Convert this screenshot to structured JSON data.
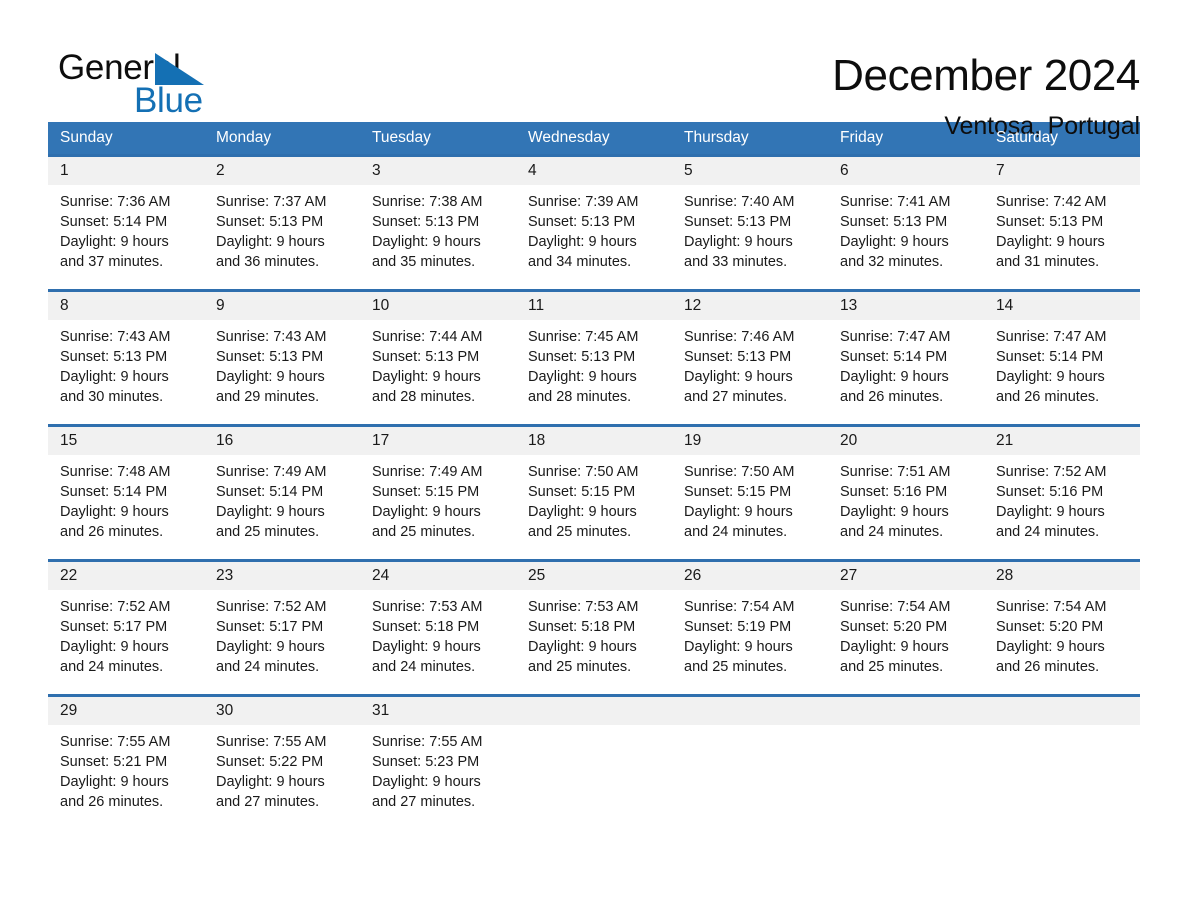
{
  "brand": {
    "word_general": "General",
    "word_blue": "Blue",
    "accent_color": "#1470b4"
  },
  "header": {
    "title": "December 2024",
    "subtitle": "Ventosa, Portugal"
  },
  "theme": {
    "header_blue": "#3275b5",
    "row_divider_blue": "#2f6fae",
    "daynum_band": "#f1f1f1"
  },
  "calendar": {
    "weekdays": [
      "Sunday",
      "Monday",
      "Tuesday",
      "Wednesday",
      "Thursday",
      "Friday",
      "Saturday"
    ],
    "weeks": [
      [
        {
          "day": "1",
          "sunrise": "Sunrise: 7:36 AM",
          "sunset": "Sunset: 5:14 PM",
          "daylight1": "Daylight: 9 hours",
          "daylight2": "and 37 minutes."
        },
        {
          "day": "2",
          "sunrise": "Sunrise: 7:37 AM",
          "sunset": "Sunset: 5:13 PM",
          "daylight1": "Daylight: 9 hours",
          "daylight2": "and 36 minutes."
        },
        {
          "day": "3",
          "sunrise": "Sunrise: 7:38 AM",
          "sunset": "Sunset: 5:13 PM",
          "daylight1": "Daylight: 9 hours",
          "daylight2": "and 35 minutes."
        },
        {
          "day": "4",
          "sunrise": "Sunrise: 7:39 AM",
          "sunset": "Sunset: 5:13 PM",
          "daylight1": "Daylight: 9 hours",
          "daylight2": "and 34 minutes."
        },
        {
          "day": "5",
          "sunrise": "Sunrise: 7:40 AM",
          "sunset": "Sunset: 5:13 PM",
          "daylight1": "Daylight: 9 hours",
          "daylight2": "and 33 minutes."
        },
        {
          "day": "6",
          "sunrise": "Sunrise: 7:41 AM",
          "sunset": "Sunset: 5:13 PM",
          "daylight1": "Daylight: 9 hours",
          "daylight2": "and 32 minutes."
        },
        {
          "day": "7",
          "sunrise": "Sunrise: 7:42 AM",
          "sunset": "Sunset: 5:13 PM",
          "daylight1": "Daylight: 9 hours",
          "daylight2": "and 31 minutes."
        }
      ],
      [
        {
          "day": "8",
          "sunrise": "Sunrise: 7:43 AM",
          "sunset": "Sunset: 5:13 PM",
          "daylight1": "Daylight: 9 hours",
          "daylight2": "and 30 minutes."
        },
        {
          "day": "9",
          "sunrise": "Sunrise: 7:43 AM",
          "sunset": "Sunset: 5:13 PM",
          "daylight1": "Daylight: 9 hours",
          "daylight2": "and 29 minutes."
        },
        {
          "day": "10",
          "sunrise": "Sunrise: 7:44 AM",
          "sunset": "Sunset: 5:13 PM",
          "daylight1": "Daylight: 9 hours",
          "daylight2": "and 28 minutes."
        },
        {
          "day": "11",
          "sunrise": "Sunrise: 7:45 AM",
          "sunset": "Sunset: 5:13 PM",
          "daylight1": "Daylight: 9 hours",
          "daylight2": "and 28 minutes."
        },
        {
          "day": "12",
          "sunrise": "Sunrise: 7:46 AM",
          "sunset": "Sunset: 5:13 PM",
          "daylight1": "Daylight: 9 hours",
          "daylight2": "and 27 minutes."
        },
        {
          "day": "13",
          "sunrise": "Sunrise: 7:47 AM",
          "sunset": "Sunset: 5:14 PM",
          "daylight1": "Daylight: 9 hours",
          "daylight2": "and 26 minutes."
        },
        {
          "day": "14",
          "sunrise": "Sunrise: 7:47 AM",
          "sunset": "Sunset: 5:14 PM",
          "daylight1": "Daylight: 9 hours",
          "daylight2": "and 26 minutes."
        }
      ],
      [
        {
          "day": "15",
          "sunrise": "Sunrise: 7:48 AM",
          "sunset": "Sunset: 5:14 PM",
          "daylight1": "Daylight: 9 hours",
          "daylight2": "and 26 minutes."
        },
        {
          "day": "16",
          "sunrise": "Sunrise: 7:49 AM",
          "sunset": "Sunset: 5:14 PM",
          "daylight1": "Daylight: 9 hours",
          "daylight2": "and 25 minutes."
        },
        {
          "day": "17",
          "sunrise": "Sunrise: 7:49 AM",
          "sunset": "Sunset: 5:15 PM",
          "daylight1": "Daylight: 9 hours",
          "daylight2": "and 25 minutes."
        },
        {
          "day": "18",
          "sunrise": "Sunrise: 7:50 AM",
          "sunset": "Sunset: 5:15 PM",
          "daylight1": "Daylight: 9 hours",
          "daylight2": "and 25 minutes."
        },
        {
          "day": "19",
          "sunrise": "Sunrise: 7:50 AM",
          "sunset": "Sunset: 5:15 PM",
          "daylight1": "Daylight: 9 hours",
          "daylight2": "and 24 minutes."
        },
        {
          "day": "20",
          "sunrise": "Sunrise: 7:51 AM",
          "sunset": "Sunset: 5:16 PM",
          "daylight1": "Daylight: 9 hours",
          "daylight2": "and 24 minutes."
        },
        {
          "day": "21",
          "sunrise": "Sunrise: 7:52 AM",
          "sunset": "Sunset: 5:16 PM",
          "daylight1": "Daylight: 9 hours",
          "daylight2": "and 24 minutes."
        }
      ],
      [
        {
          "day": "22",
          "sunrise": "Sunrise: 7:52 AM",
          "sunset": "Sunset: 5:17 PM",
          "daylight1": "Daylight: 9 hours",
          "daylight2": "and 24 minutes."
        },
        {
          "day": "23",
          "sunrise": "Sunrise: 7:52 AM",
          "sunset": "Sunset: 5:17 PM",
          "daylight1": "Daylight: 9 hours",
          "daylight2": "and 24 minutes."
        },
        {
          "day": "24",
          "sunrise": "Sunrise: 7:53 AM",
          "sunset": "Sunset: 5:18 PM",
          "daylight1": "Daylight: 9 hours",
          "daylight2": "and 24 minutes."
        },
        {
          "day": "25",
          "sunrise": "Sunrise: 7:53 AM",
          "sunset": "Sunset: 5:18 PM",
          "daylight1": "Daylight: 9 hours",
          "daylight2": "and 25 minutes."
        },
        {
          "day": "26",
          "sunrise": "Sunrise: 7:54 AM",
          "sunset": "Sunset: 5:19 PM",
          "daylight1": "Daylight: 9 hours",
          "daylight2": "and 25 minutes."
        },
        {
          "day": "27",
          "sunrise": "Sunrise: 7:54 AM",
          "sunset": "Sunset: 5:20 PM",
          "daylight1": "Daylight: 9 hours",
          "daylight2": "and 25 minutes."
        },
        {
          "day": "28",
          "sunrise": "Sunrise: 7:54 AM",
          "sunset": "Sunset: 5:20 PM",
          "daylight1": "Daylight: 9 hours",
          "daylight2": "and 26 minutes."
        }
      ],
      [
        {
          "day": "29",
          "sunrise": "Sunrise: 7:55 AM",
          "sunset": "Sunset: 5:21 PM",
          "daylight1": "Daylight: 9 hours",
          "daylight2": "and 26 minutes."
        },
        {
          "day": "30",
          "sunrise": "Sunrise: 7:55 AM",
          "sunset": "Sunset: 5:22 PM",
          "daylight1": "Daylight: 9 hours",
          "daylight2": "and 27 minutes."
        },
        {
          "day": "31",
          "sunrise": "Sunrise: 7:55 AM",
          "sunset": "Sunset: 5:23 PM",
          "daylight1": "Daylight: 9 hours",
          "daylight2": "and 27 minutes."
        },
        {
          "day": "",
          "sunrise": "",
          "sunset": "",
          "daylight1": "",
          "daylight2": ""
        },
        {
          "day": "",
          "sunrise": "",
          "sunset": "",
          "daylight1": "",
          "daylight2": ""
        },
        {
          "day": "",
          "sunrise": "",
          "sunset": "",
          "daylight1": "",
          "daylight2": ""
        },
        {
          "day": "",
          "sunrise": "",
          "sunset": "",
          "daylight1": "",
          "daylight2": ""
        }
      ]
    ]
  }
}
